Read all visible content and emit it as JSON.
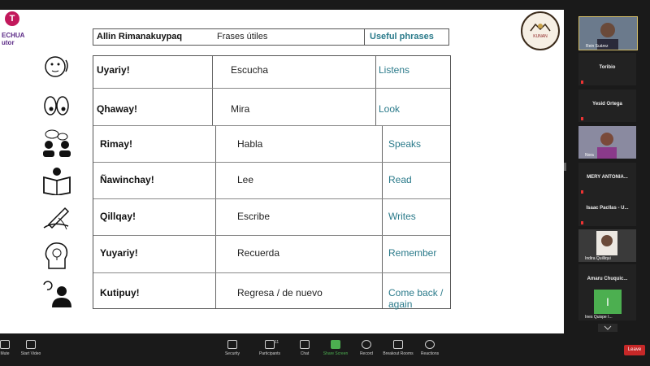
{
  "slide": {
    "logo_letter": "T",
    "logo_line1": "ECHUA",
    "logo_line2": "utor",
    "seal_text": "KUNAN",
    "header": [
      "Allin Rimanakuypaq",
      "Frases útiles",
      "Useful phrases"
    ],
    "rows": [
      {
        "quechua": "Uyariy!",
        "spanish": "Escucha",
        "english": "Listens"
      },
      {
        "quechua": "Qhaway!",
        "spanish": "Mira",
        "english": "Look"
      },
      {
        "quechua": "Rimay!",
        "spanish": "Habla",
        "english": "Speaks"
      },
      {
        "quechua": "Ñawinchay!",
        "spanish": "Lee",
        "english": "Read"
      },
      {
        "quechua": "Qillqay!",
        "spanish": "Escribe",
        "english": "Writes"
      },
      {
        "quechua": "Yuyariy!",
        "spanish": "Recuerda",
        "english": "Remember"
      },
      {
        "quechua": "Kutipuy!",
        "spanish": "Regresa / de nuevo",
        "english": "Come back / again"
      }
    ]
  },
  "participants": [
    {
      "name": "Rein Suárez",
      "video": true
    },
    {
      "name": "Toribio",
      "video": false
    },
    {
      "name": "Yesid Ortega",
      "video": false
    },
    {
      "name": "Nora",
      "video": true
    },
    {
      "name": "MERY ANTONIA...",
      "video": false
    },
    {
      "name": "Isaac Pacllas - U...",
      "video": false
    },
    {
      "name": "Indira Quilliqui",
      "video": true
    },
    {
      "name": "Amaru Chuquic...",
      "video": false
    },
    {
      "name": "Ines Quispe I...",
      "video": false,
      "avatar_letter": "I"
    }
  ],
  "toolbar": {
    "mute": "Mute",
    "start_video": "Start Video",
    "security": "Security",
    "participants": "Participants",
    "participants_count": "11",
    "chat": "Chat",
    "share_screen": "Share Screen",
    "record": "Record",
    "breakout": "Breakout Rooms",
    "reactions": "Reactions",
    "leave": "Leave"
  },
  "colors": {
    "english_text": "#2a7a8a",
    "share_screen": "#4caf50",
    "leave": "#c62828"
  }
}
